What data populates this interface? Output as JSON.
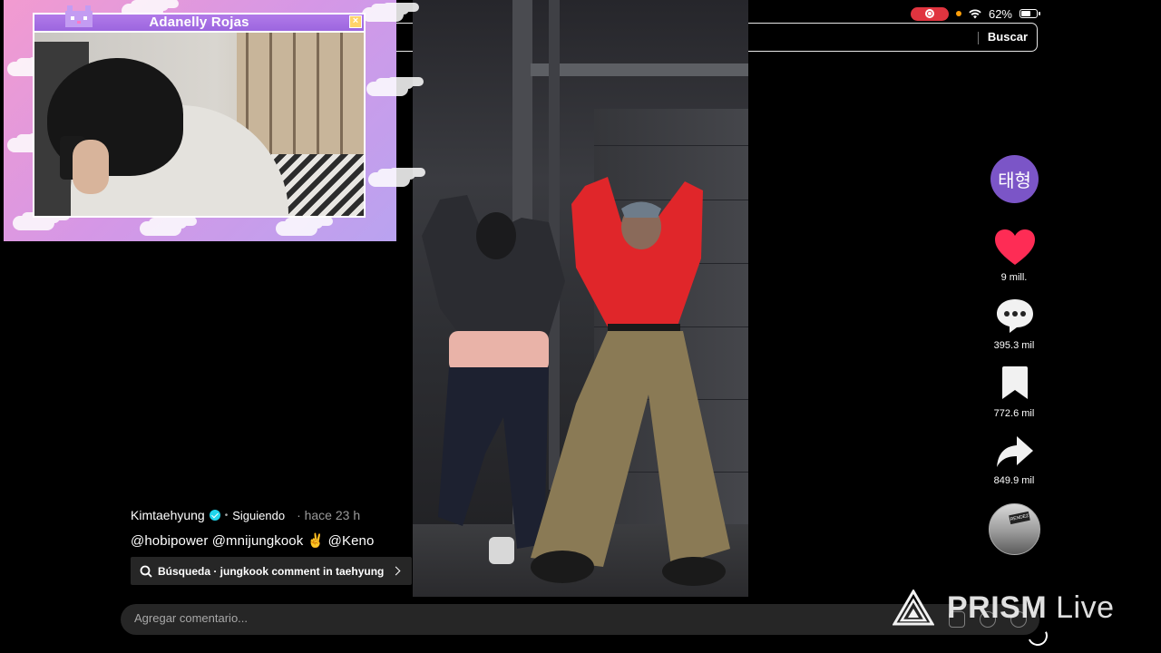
{
  "status": {
    "battery": "62%",
    "battery_level": 0.62
  },
  "search": {
    "button": "Buscar"
  },
  "overlay": {
    "name": "Adanelly Rojas",
    "close": "×"
  },
  "rail": {
    "avatar_text": "태형",
    "likes": "9 mill.",
    "comments": "395.3 mil",
    "saves": "772.6 mil",
    "shares": "849.9 mil",
    "disc_sign": "RENDEZ"
  },
  "caption": {
    "username": "Kimtaehyung",
    "separator": "•",
    "follow_status": "Siguiendo",
    "time": "· hace 23 h",
    "text": "@hobipower @mnijungkook  ✌️ @Keno"
  },
  "suggestion": {
    "label": "Búsqueda · jungkook comment in taehyung"
  },
  "comment_bar": {
    "placeholder": "Agregar comentario..."
  },
  "watermark": {
    "brand": "PRISM",
    "suffix": " Live"
  },
  "colors": {
    "accent_purple": "#7b55c7",
    "like_red": "#fe2c55",
    "verified": "#20d5ec",
    "rec_red": "#e0343f"
  }
}
